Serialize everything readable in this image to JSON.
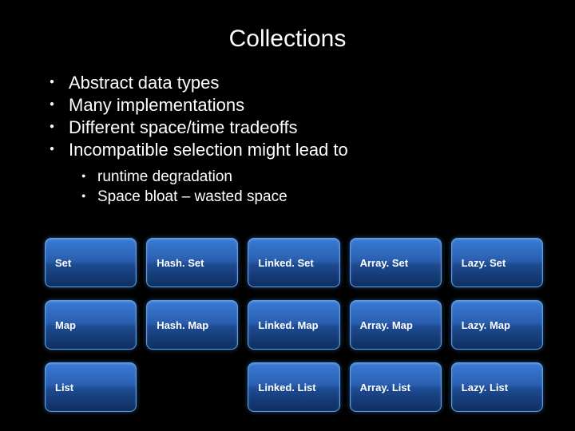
{
  "title": "Collections",
  "bullets": [
    "Abstract data types",
    "Many implementations",
    "Different space/time tradeoffs",
    "Incompatible selection might lead to"
  ],
  "sub_bullets": [
    "runtime degradation",
    "Space bloat – wasted space"
  ],
  "grid": {
    "rows": [
      [
        "Set",
        "Hash. Set",
        "Linked. Set",
        "Array. Set",
        "Lazy. Set"
      ],
      [
        "Map",
        "Hash. Map",
        "Linked. Map",
        "Array. Map",
        "Lazy. Map"
      ],
      [
        "List",
        "",
        "Linked. List",
        "Array. List",
        "Lazy. List"
      ]
    ]
  }
}
